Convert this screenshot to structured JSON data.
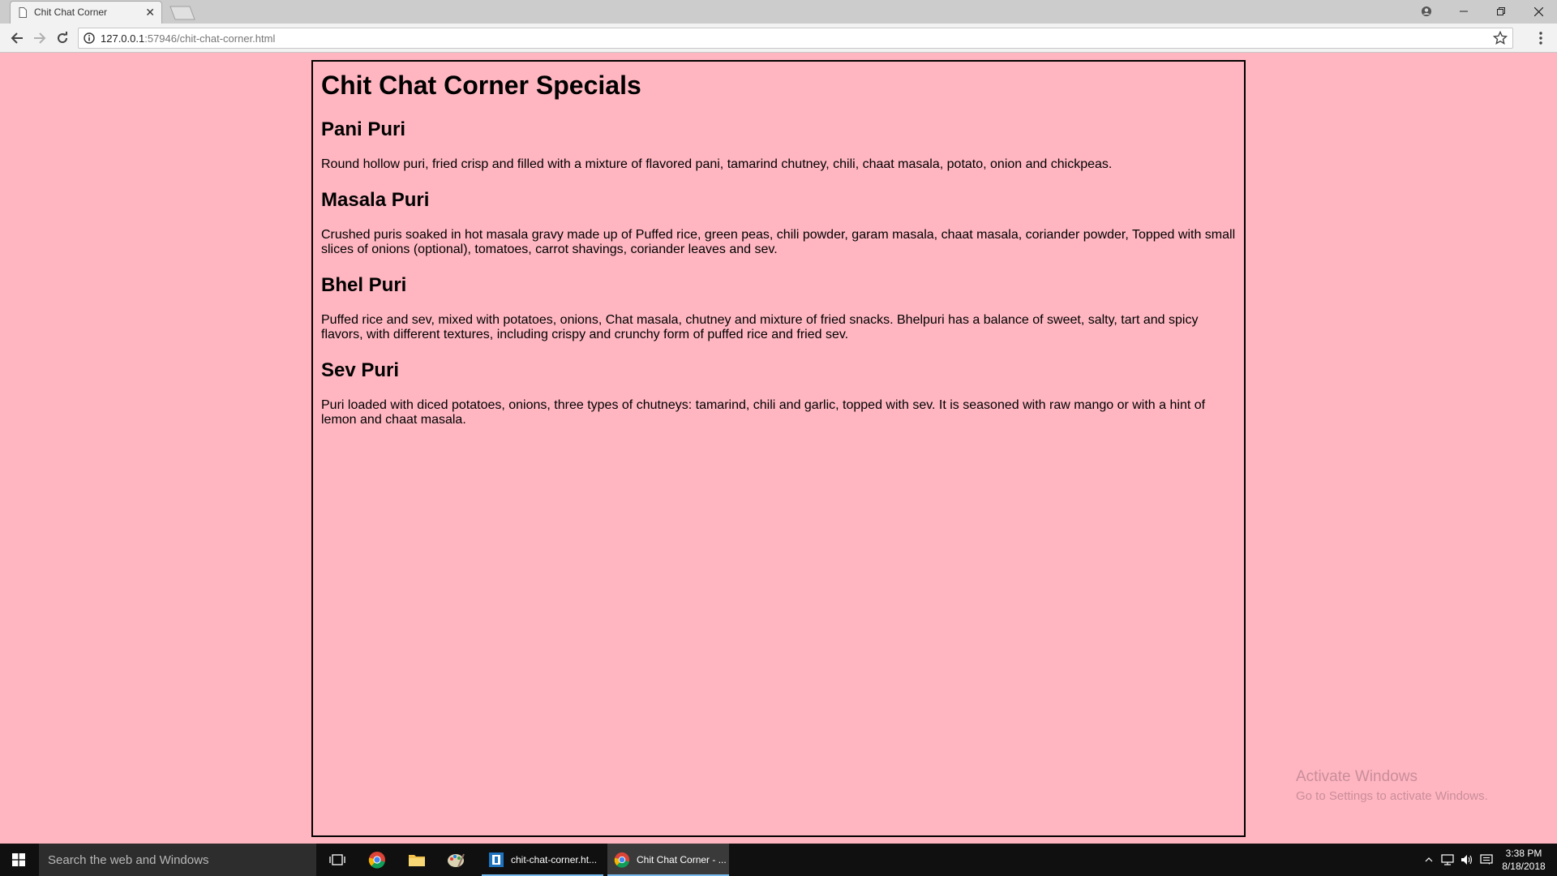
{
  "browser": {
    "tab_title": "Chit Chat Corner",
    "url_host": "127.0.0.1",
    "url_path": ":57946/chit-chat-corner.html"
  },
  "page": {
    "title": "Chit Chat Corner Specials",
    "items": [
      {
        "name": "Pani Puri",
        "description": "Round hollow puri, fried crisp and filled with a mixture of flavored pani, tamarind chutney, chili, chaat masala, potato, onion and chickpeas."
      },
      {
        "name": "Masala Puri",
        "description": "Crushed puris soaked in hot masala gravy made up of Puffed rice, green peas, chili powder, garam masala, chaat masala, coriander powder, Topped with small slices of onions (optional), tomatoes, carrot shavings, coriander leaves and sev."
      },
      {
        "name": "Bhel Puri",
        "description": "Puffed rice and sev, mixed with potatoes, onions, Chat masala, chutney and mixture of fried snacks. Bhelpuri has a balance of sweet, salty, tart and spicy flavors, with different textures, including crispy and crunchy form of puffed rice and fried sev."
      },
      {
        "name": "Sev Puri",
        "description": "Puri loaded with diced potatoes, onions, three types of chutneys: tamarind, chili and garlic, topped with sev. It is seasoned with raw mango or with a hint of lemon and chaat masala."
      }
    ]
  },
  "watermark": {
    "title": "Activate Windows",
    "subtitle": "Go to Settings to activate Windows."
  },
  "taskbar": {
    "search_placeholder": "Search the web and Windows",
    "apps": [
      {
        "label": "chit-chat-corner.ht...",
        "icon": "editor-icon"
      },
      {
        "label": "Chit Chat Corner - ...",
        "icon": "chrome-icon"
      }
    ],
    "time": "3:38 PM",
    "date": "8/18/2018"
  },
  "colors": {
    "page_background": "#ffb6c1",
    "taskbar": "#101010"
  }
}
